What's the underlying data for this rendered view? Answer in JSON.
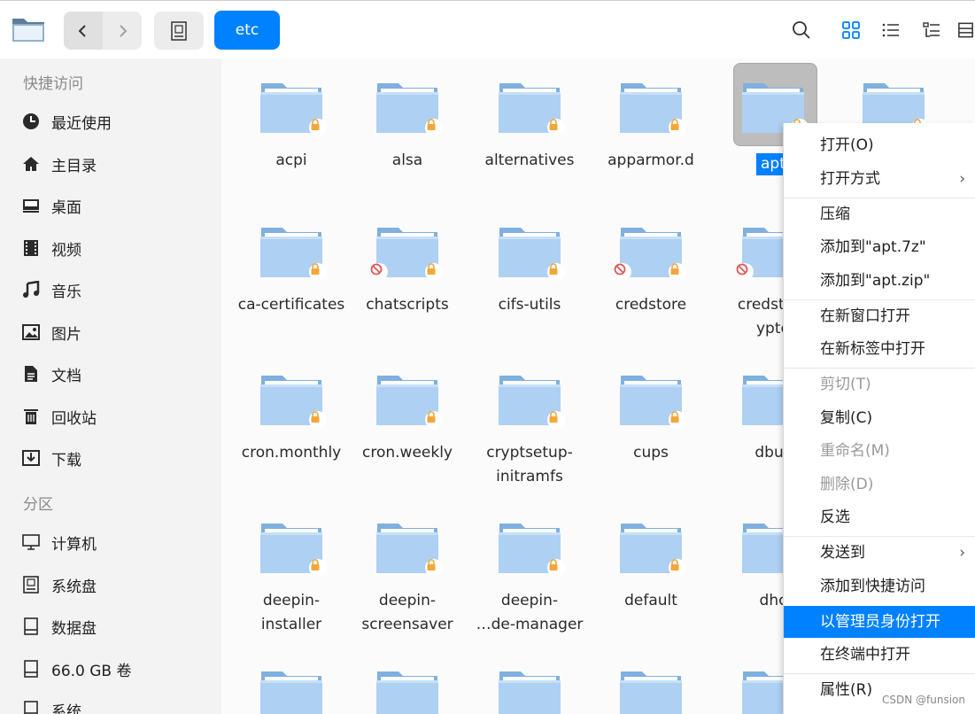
{
  "toolbar": {
    "breadcrumb": "etc",
    "back_icon": "chevron-left-icon",
    "forward_icon": "chevron-right-icon"
  },
  "sidebar": {
    "quick_title": "快捷访问",
    "quick_items": [
      {
        "label": "最近使用",
        "icon": "clock-icon"
      },
      {
        "label": "主目录",
        "icon": "home-icon"
      },
      {
        "label": "桌面",
        "icon": "desktop-icon"
      },
      {
        "label": "视频",
        "icon": "video-icon"
      },
      {
        "label": "音乐",
        "icon": "music-icon"
      },
      {
        "label": "图片",
        "icon": "picture-icon"
      },
      {
        "label": "文档",
        "icon": "document-icon"
      },
      {
        "label": "回收站",
        "icon": "trash-icon"
      },
      {
        "label": "下载",
        "icon": "download-icon"
      }
    ],
    "partition_title": "分区",
    "partition_items": [
      {
        "label": "计算机",
        "icon": "computer-icon"
      },
      {
        "label": "系统盘",
        "icon": "system-disk-icon"
      },
      {
        "label": "数据盘",
        "icon": "disk-icon"
      },
      {
        "label": "66.0 GB 卷",
        "icon": "disk-icon"
      },
      {
        "label": "系统",
        "icon": "disk-icon"
      }
    ]
  },
  "files": [
    {
      "name": "acpi",
      "lines": [
        "acpi"
      ],
      "forbid": false
    },
    {
      "name": "alsa",
      "lines": [
        "alsa"
      ],
      "forbid": false
    },
    {
      "name": "alternatives",
      "lines": [
        "alternatives"
      ],
      "forbid": false
    },
    {
      "name": "apparmor.d",
      "lines": [
        "apparmor.d"
      ],
      "forbid": false
    },
    {
      "name": "apt",
      "lines": [
        "apt"
      ],
      "forbid": false,
      "selected": true
    },
    {
      "name": "",
      "lines": [
        ""
      ],
      "forbid": false
    },
    {
      "name": "ca-certificates",
      "lines": [
        "ca-certificates"
      ],
      "forbid": false
    },
    {
      "name": "chatscripts",
      "lines": [
        "chatscripts"
      ],
      "forbid": true
    },
    {
      "name": "cifs-utils",
      "lines": [
        "cifs-utils"
      ],
      "forbid": false
    },
    {
      "name": "credstore",
      "lines": [
        "credstore"
      ],
      "forbid": true
    },
    {
      "name": "credstore…ypte",
      "lines": [
        "credstore",
        "ypte"
      ],
      "forbid": true
    },
    {
      "name": "cron.monthly",
      "lines": [
        "cron.monthly"
      ],
      "forbid": false
    },
    {
      "name": "cron.weekly",
      "lines": [
        "cron.weekly"
      ],
      "forbid": false
    },
    {
      "name": "cryptsetup-initramfs",
      "lines": [
        "cryptsetup-",
        "initramfs"
      ],
      "forbid": false
    },
    {
      "name": "cups",
      "lines": [
        "cups"
      ],
      "forbid": false
    },
    {
      "name": "dbus",
      "lines": [
        "dbus"
      ],
      "forbid": false
    },
    {
      "name": "deepin-installer",
      "lines": [
        "deepin-",
        "installer"
      ],
      "forbid": false
    },
    {
      "name": "deepin-screensaver",
      "lines": [
        "deepin-",
        "screensaver"
      ],
      "forbid": false
    },
    {
      "name": "deepin-…de-manager",
      "lines": [
        "deepin-",
        "…de-manager"
      ],
      "forbid": false
    },
    {
      "name": "default",
      "lines": [
        "default"
      ],
      "forbid": false
    },
    {
      "name": "dhc",
      "lines": [
        "dhc"
      ],
      "forbid": false
    }
  ],
  "context_menu": {
    "items": [
      {
        "label": "打开(O)",
        "state": "normal"
      },
      {
        "label": "打开方式",
        "state": "normal",
        "submenu": true
      },
      {
        "label": "压缩",
        "state": "normal"
      },
      {
        "label": "添加到\"apt.7z\"",
        "state": "normal"
      },
      {
        "label": "添加到\"apt.zip\"",
        "state": "normal"
      },
      {
        "label": "在新窗口打开",
        "state": "normal"
      },
      {
        "label": "在新标签中打开",
        "state": "normal"
      },
      {
        "label": "剪切(T)",
        "state": "disabled"
      },
      {
        "label": "复制(C)",
        "state": "normal"
      },
      {
        "label": "重命名(M)",
        "state": "disabled"
      },
      {
        "label": "删除(D)",
        "state": "disabled"
      },
      {
        "label": "反选",
        "state": "normal"
      },
      {
        "label": "发送到",
        "state": "normal",
        "submenu": true
      },
      {
        "label": "添加到快捷访问",
        "state": "normal"
      },
      {
        "label": "以管理员身份打开",
        "state": "active"
      },
      {
        "label": "在终端中打开",
        "state": "normal"
      },
      {
        "label": "属性(R)",
        "state": "normal"
      }
    ]
  },
  "watermark": "CSDN @funsion",
  "colors": {
    "accent": "#0081ff",
    "folder": "#a9cdf3",
    "lock": "#f3a73b",
    "forbid": "#e05656"
  }
}
